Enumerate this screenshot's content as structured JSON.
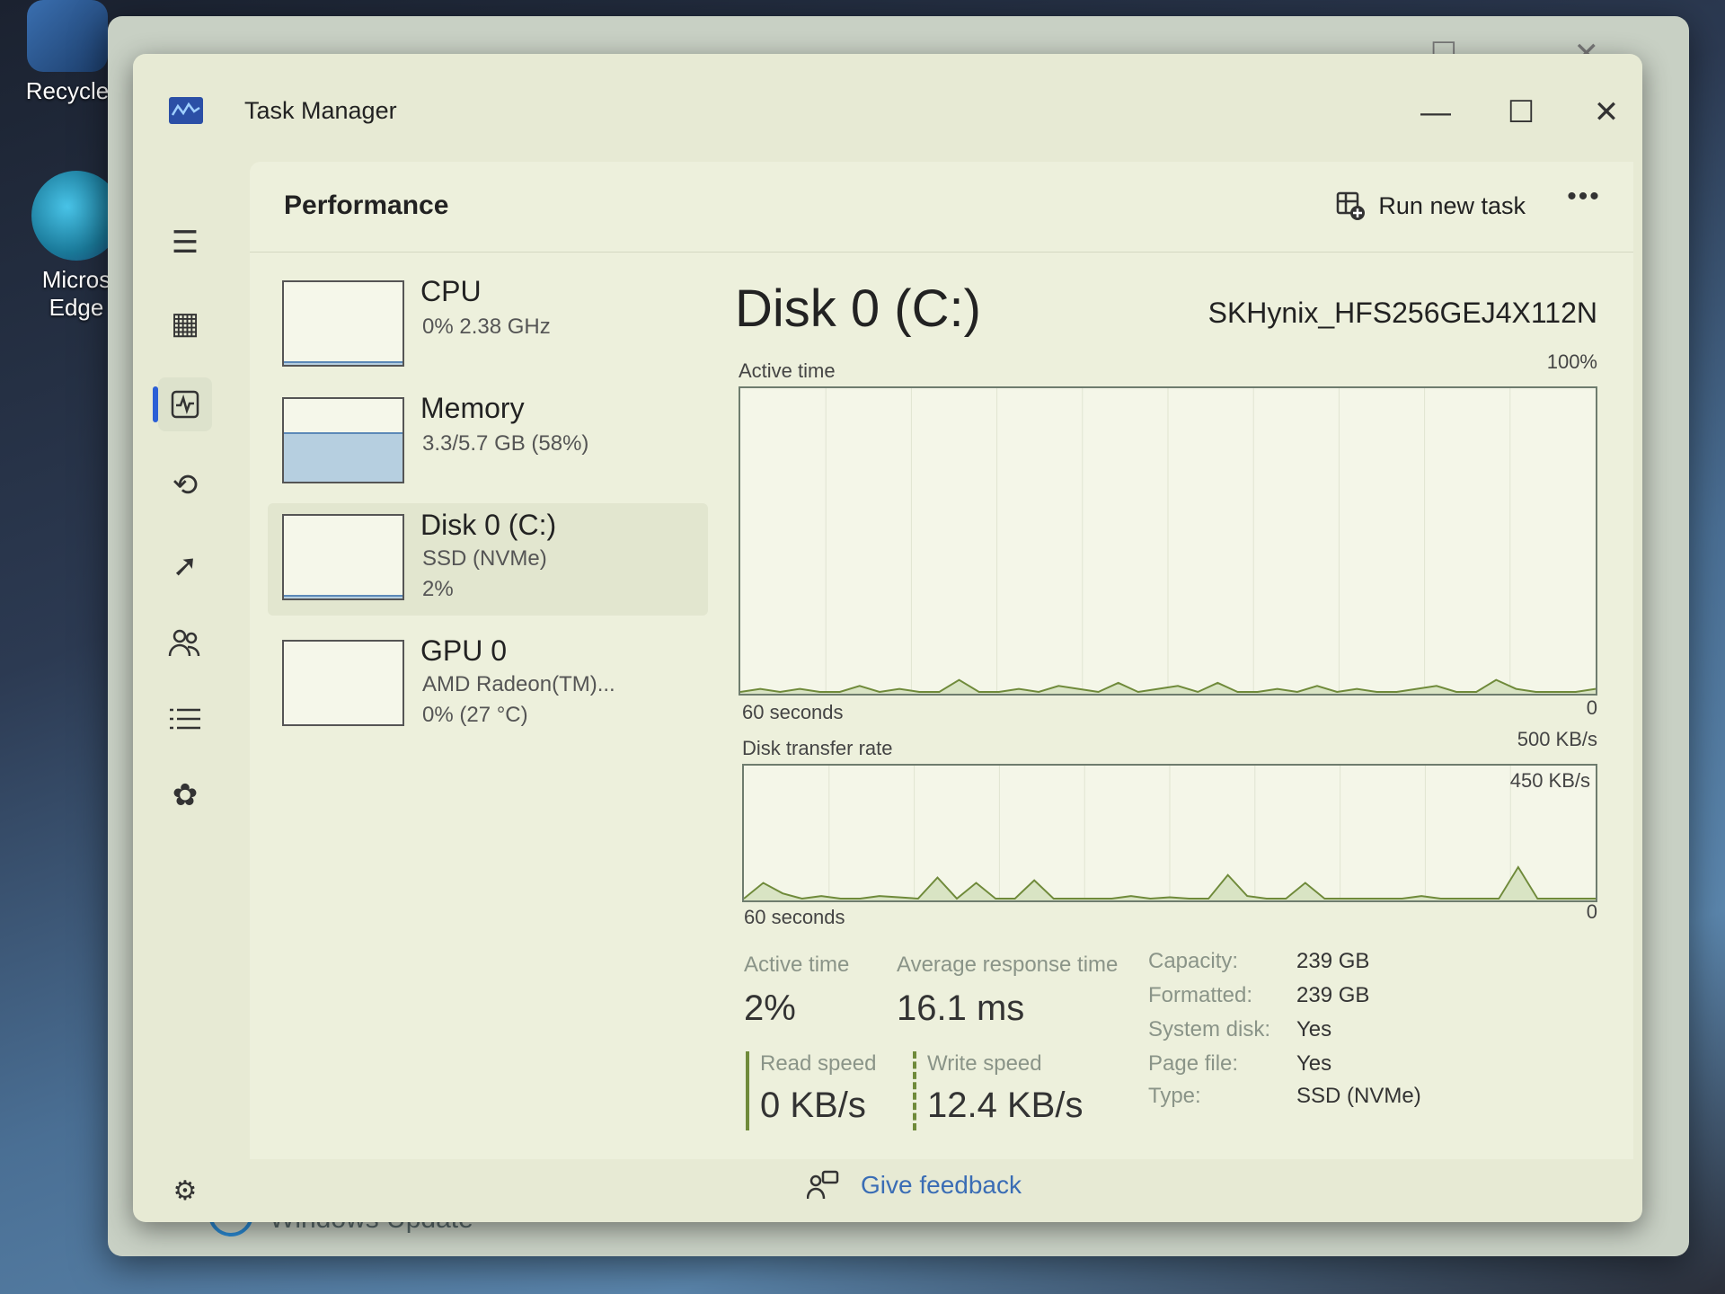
{
  "desktop": {
    "icons": [
      {
        "label": "Recycle",
        "icon": "recycle-bin-icon"
      },
      {
        "label": "Micros Edge",
        "icon": "edge-icon"
      }
    ]
  },
  "background_window": {
    "bottom_text": "Windows Update"
  },
  "window": {
    "title": "Task Manager",
    "controls": {
      "minimize": "—",
      "maximize": "☐",
      "close": "✕"
    }
  },
  "nav": {
    "items": [
      {
        "name": "hamburger-menu-icon",
        "glyph": "☰"
      },
      {
        "name": "processes-icon",
        "glyph": "▦"
      },
      {
        "name": "performance-icon",
        "glyph": "⩘"
      },
      {
        "name": "app-history-icon",
        "glyph": "⟲"
      },
      {
        "name": "startup-apps-icon",
        "glyph": "➚"
      },
      {
        "name": "users-icon",
        "glyph": "👥"
      },
      {
        "name": "details-icon",
        "glyph": "☰"
      },
      {
        "name": "services-icon",
        "glyph": "✿"
      },
      {
        "name": "settings-icon",
        "glyph": "⚙"
      }
    ],
    "active": "performance"
  },
  "header": {
    "title": "Performance",
    "run_new_task": "Run new task",
    "more": "•••"
  },
  "perf_list": [
    {
      "name": "CPU",
      "line1": "0%  2.38 GHz",
      "line2": "",
      "fill_pct": 2
    },
    {
      "name": "Memory",
      "line1": "3.3/5.7 GB (58%)",
      "line2": "",
      "fill_pct": 58
    },
    {
      "name": "Disk 0 (C:)",
      "line1": "SSD (NVMe)",
      "line2": "2%",
      "fill_pct": 2
    },
    {
      "name": "GPU 0",
      "line1": "AMD Radeon(TM)...",
      "line2": "0%  (27 °C)",
      "fill_pct": 0
    }
  ],
  "detail": {
    "title": "Disk 0 (C:)",
    "model": "SKHynix_HFS256GEJ4X112N",
    "active_time_graph": {
      "label": "Active time",
      "max_label": "100%",
      "min_label": "0",
      "time_label": "60 seconds"
    },
    "transfer_graph": {
      "label": "Disk transfer rate",
      "max_label": "500 KB/s",
      "ref_label": "450 KB/s",
      "min_label": "0",
      "time_label": "60 seconds"
    },
    "stats": {
      "active_time_label": "Active time",
      "active_time_value": "2%",
      "avg_response_label": "Average response time",
      "avg_response_value": "16.1 ms",
      "read_speed_label": "Read speed",
      "read_speed_value": "0 KB/s",
      "write_speed_label": "Write speed",
      "write_speed_value": "12.4 KB/s"
    },
    "properties": [
      {
        "label": "Capacity:",
        "value": "239 GB"
      },
      {
        "label": "Formatted:",
        "value": "239 GB"
      },
      {
        "label": "System disk:",
        "value": "Yes"
      },
      {
        "label": "Page file:",
        "value": "Yes"
      },
      {
        "label": "Type:",
        "value": "SSD (NVMe)"
      }
    ]
  },
  "footer": {
    "feedback": "Give feedback"
  },
  "chart_data": [
    {
      "type": "line",
      "title": "Active time",
      "ylim": [
        0,
        100
      ],
      "xlabel": "60 seconds",
      "values": [
        0,
        1,
        0,
        1,
        0,
        0,
        2,
        0,
        1,
        0,
        0,
        4,
        0,
        0,
        1,
        0,
        2,
        1,
        0,
        3,
        0,
        1,
        2,
        0,
        3,
        0,
        0,
        1,
        0,
        2,
        0,
        1,
        0,
        0,
        1,
        2,
        0,
        0,
        4,
        1,
        0,
        0,
        0,
        1
      ]
    },
    {
      "type": "line",
      "title": "Disk transfer rate",
      "ylim": [
        0,
        500
      ],
      "xlabel": "60 seconds",
      "values": [
        0,
        60,
        20,
        0,
        10,
        0,
        0,
        10,
        5,
        0,
        80,
        0,
        60,
        0,
        0,
        70,
        0,
        0,
        0,
        0,
        10,
        0,
        5,
        0,
        0,
        90,
        10,
        0,
        0,
        60,
        0,
        0,
        0,
        0,
        0,
        10,
        0,
        0,
        0,
        0,
        120,
        0,
        0,
        0,
        0
      ]
    }
  ]
}
